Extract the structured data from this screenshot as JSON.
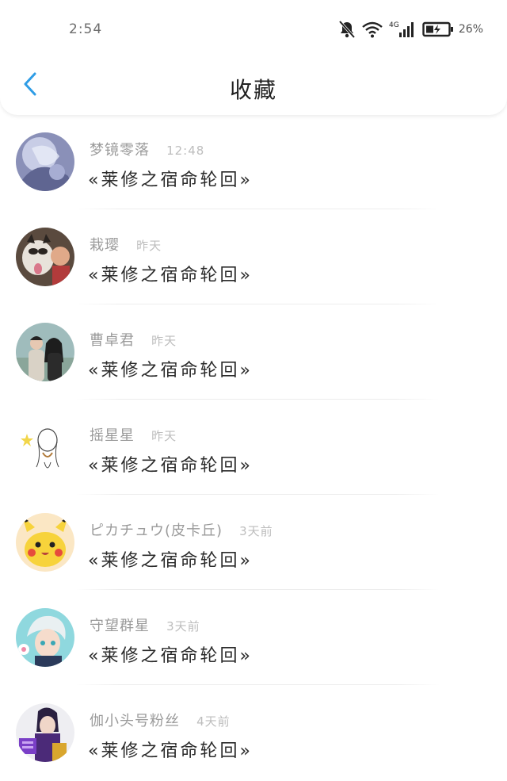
{
  "status_bar": {
    "time": "2:54",
    "network": "4G",
    "battery": "26%"
  },
  "nav": {
    "title": "收藏",
    "back_icon": "chevron-left-icon",
    "accent": "#2f9de6"
  },
  "items": [
    {
      "user": "梦镜零落",
      "time": "12:48",
      "title": "«莱修之宿命轮回»",
      "avatar": "fantasy-art-avatar"
    },
    {
      "user": "栽璎",
      "time": "昨天",
      "title": "«莱修之宿命轮回»",
      "avatar": "dog-photo-avatar"
    },
    {
      "user": "曹卓君",
      "time": "昨天",
      "title": "«莱修之宿命轮回»",
      "avatar": "couple-photo-avatar"
    },
    {
      "user": "摇星星",
      "time": "昨天",
      "title": "«莱修之宿命轮回»",
      "avatar": "sketch-girl-avatar"
    },
    {
      "user": "ピカチュウ(皮卡丘)",
      "time": "3天前",
      "title": "«莱修之宿命轮回»",
      "avatar": "pikachu-avatar"
    },
    {
      "user": "守望群星",
      "time": "3天前",
      "title": "«莱修之宿命轮回»",
      "avatar": "anime-boy-avatar"
    },
    {
      "user": "伽小头号粉丝",
      "time": "4天前",
      "title": "«莱修之宿命轮回»",
      "avatar": "purple-character-avatar"
    }
  ]
}
